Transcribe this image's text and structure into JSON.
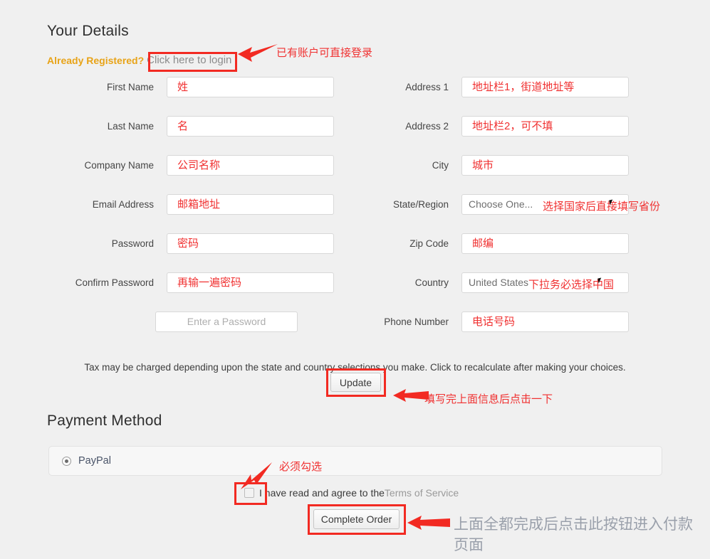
{
  "sections": {
    "details_title": "Your Details",
    "payment_title": "Payment Method"
  },
  "already_registered": {
    "label": "Already Registered?",
    "link": "Click here to login"
  },
  "left_fields": [
    {
      "label": "First Name",
      "value": "姓"
    },
    {
      "label": "Last Name",
      "value": "名"
    },
    {
      "label": "Company Name",
      "value": "公司名称"
    },
    {
      "label": "Email Address",
      "value": "邮箱地址"
    },
    {
      "label": "Password",
      "value": "密码"
    },
    {
      "label": "Confirm Password",
      "value": "再输一遍密码"
    }
  ],
  "password_strength": {
    "placeholder": "Enter a Password"
  },
  "right_fields": [
    {
      "label": "Address 1",
      "value": "地址栏1，街道地址等"
    },
    {
      "label": "Address 2",
      "value": "地址栏2，可不填"
    },
    {
      "label": "City",
      "value": "城市"
    },
    {
      "label": "State/Region",
      "value": "Choose One...",
      "note": "选择国家后直接填写省份"
    },
    {
      "label": "Zip Code",
      "value": "邮编"
    },
    {
      "label": "Country",
      "value": "United States",
      "note": "下拉务必选择中国"
    },
    {
      "label": "Phone Number",
      "value": "电话号码"
    }
  ],
  "tax_note": "Tax may be charged depending upon the state and country selections you make. Click to recalculate after making your choices.",
  "update_button": "Update",
  "payment": {
    "paypal_label": "PayPal"
  },
  "terms": {
    "prefix": "I have read and agree to the ",
    "link": "Terms of Service"
  },
  "complete_button": "Complete Order",
  "annotations": [
    {
      "name": "login-annotation",
      "text": "已有账户可直接登录"
    },
    {
      "name": "update-annotation",
      "text": "填写完上面信息后点击一下"
    },
    {
      "name": "checkbox-annotation",
      "text": "必须勾选"
    },
    {
      "name": "complete-annotation",
      "text": "上面全都完成后点击此按钮进入付款页面"
    }
  ],
  "colors": {
    "page_bg": "#f0f0f0",
    "highlight": "#f22a22",
    "annotation_red": "#f03030",
    "already_gold": "#e8a317",
    "big_note_gray": "#9aa0ab"
  }
}
